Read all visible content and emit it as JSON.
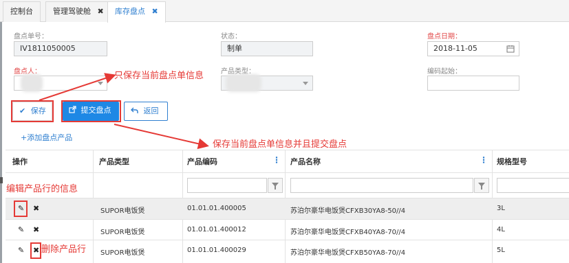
{
  "tabs": [
    {
      "label": "控制台",
      "closable": false,
      "active": false
    },
    {
      "label": "管理驾驶舱",
      "closable": true,
      "active": false
    },
    {
      "label": "库存盘点",
      "closable": true,
      "active": true
    }
  ],
  "tab_close_glyph": "✖",
  "form": {
    "order_no": {
      "label": "盘点单号：",
      "value": "IV1811050005"
    },
    "status": {
      "label": "状态：",
      "value": "制单"
    },
    "date": {
      "label": "盘点日期：",
      "value": "2018-11-05"
    },
    "person": {
      "label": "盘点人："
    },
    "product_type": {
      "label": "产品类型："
    },
    "code_start": {
      "label": "编码起始：",
      "value": ""
    }
  },
  "buttons": {
    "save": "保存",
    "submit": "提交盘点",
    "back": "返回",
    "add_product": "+添加盘点产品"
  },
  "annotations": {
    "save_note": "只保存当前盘点单信息",
    "submit_note": "保存当前盘点单信息并且提交盘点",
    "edit_note": "编辑产品行的信息",
    "delete_note": "删除产品行"
  },
  "table": {
    "columns": [
      "操作",
      "产品类型",
      "产品编码",
      "产品名称",
      "规格型号"
    ],
    "rows": [
      {
        "type": "SUPOR电饭煲",
        "code": "01.01.01.400005",
        "name": "苏泊尔豪华电饭煲CFXB30YA8-50//4",
        "spec": "3L"
      },
      {
        "type": "SUPOR电饭煲",
        "code": "01.01.01.400012",
        "name": "苏泊尔豪华电饭煲CFXB40YA8-70//4",
        "spec": "4L"
      },
      {
        "type": "SUPOR电饭煲",
        "code": "01.01.01.400029",
        "name": "苏泊尔豪华电饭煲CFXB50YA8-70//4",
        "spec": "5L"
      }
    ]
  },
  "icons": {
    "save": "checkmark-icon",
    "submit": "external-link-icon",
    "back": "undo-arrow-icon",
    "edit": "pencil-icon",
    "delete": "x-icon",
    "calendar": "calendar-icon",
    "filter": "funnel-icon",
    "column_menu": "vertical-dots-icon"
  },
  "colors": {
    "accent": "#2f7fd0",
    "primary_button": "#1e88e5",
    "annotation": "#e53935",
    "required_label": "#e24848"
  }
}
